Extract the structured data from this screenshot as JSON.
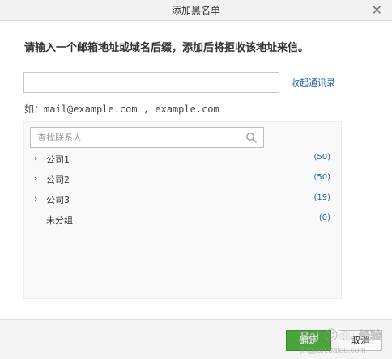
{
  "dialog": {
    "title": "添加黑名单",
    "close_icon": "close-icon",
    "instruction": "请输入一个邮箱地址或域名后缀，添加后将拒收该地址来信。",
    "email_input": {
      "value": "",
      "placeholder": ""
    },
    "collapse_link": "收起通讯录",
    "example_prefix": "如：",
    "example_text": "mail@example.com , example.com"
  },
  "contacts": {
    "search_placeholder": "查找联系人",
    "search_icon": "search-icon",
    "groups": [
      {
        "name": "公司1",
        "count": "(50)",
        "expandable": true
      },
      {
        "name": "公司2",
        "count": "(50)",
        "expandable": true
      },
      {
        "name": "公司3",
        "count": "(19)",
        "expandable": true
      },
      {
        "name": "未分组",
        "count": "(0)",
        "expandable": false
      }
    ]
  },
  "footer": {
    "ok_label": "确定",
    "cancel_label": "取消"
  },
  "watermark": {
    "text": "Baidu 经验",
    "url_text": "jingyan.baidu.com"
  },
  "colors": {
    "ok_green": "#4aa43c",
    "link_blue": "#1f5fa6",
    "title_bar": "#f2f2f2",
    "panel_bg": "#f9f9f9"
  }
}
